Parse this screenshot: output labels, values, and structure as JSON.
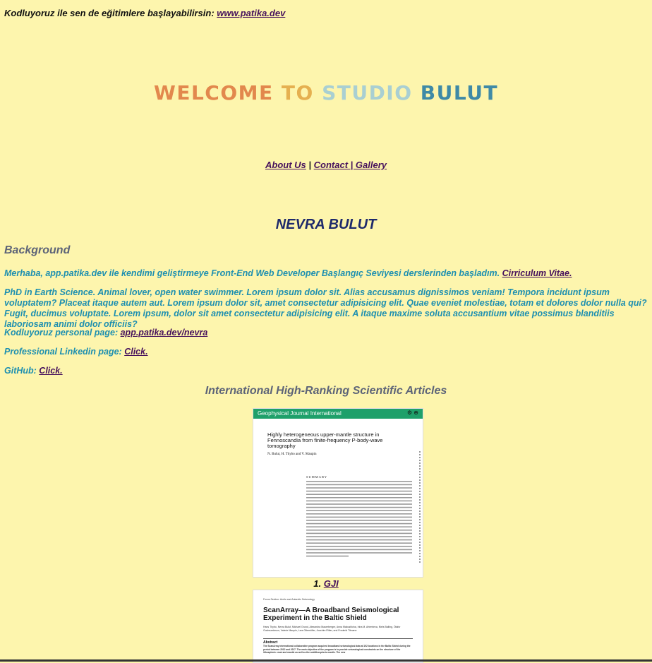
{
  "top": {
    "text": "Kodluyoruz ile sen de eğitimlere başlayabilirsin: ",
    "link": "www.patika.dev"
  },
  "welcome": {
    "word1": "WELCOME",
    "word2": "TO",
    "word3": "STUDIO",
    "word4": "BULUT",
    "colors": [
      "#e2884d",
      "#e5b050",
      "#a9cfd2",
      "#3f8aa6"
    ]
  },
  "nav": {
    "about": "About Us",
    "sep1": " | ",
    "contact": "Contact | ",
    "gallery": "Gallery"
  },
  "profile": {
    "name": "NEVRA BULUT",
    "background_heading": "Background",
    "intro": "Merhaba, app.patika.dev ile kendimi geliştirmeye Front-End Web Developer Başlangıç Seviyesi derslerinden başladım. ",
    "cv_link": "Cirriculum Vitae.",
    "bio": "PhD in Earth Science. Animal lover, open water swimmer. Lorem ipsum dolor sit. Alias accusamus dignissimos veniam! Tempora incidunt ipsum voluptatem? Placeat itaque autem aut. Lorem ipsum dolor sit, amet consectetur adipisicing elit. Quae eveniet molestiae, totam et dolores dolor nulla qui? Fugit, ducimus voluptate. Lorem ipsum, dolor sit amet consectetur adipisicing elit. A itaque maxime soluta accusantium vitae possimus blanditiis laboriosam animi dolor officiis?",
    "kodluyoruz_label": "Kodluyoruz personal page: ",
    "kodluyoruz_link": "app.patika.dev/nevra",
    "linkedin_label": "Professional Linkedin page: ",
    "linkedin_link": "Click.",
    "github_label": "GitHub: ",
    "github_link": "Click."
  },
  "articles": {
    "heading": "International High-Ranking Scientific Articles",
    "paper1": {
      "journal": "Geophysical Journal International",
      "title": "Highly heterogeneous upper-mantle structure in Fennoscandia from finite-frequency P-body-wave tomography",
      "authors": "N. Bulut, H. Thybo and V. Maupin",
      "summary_heading": "SUMMARY",
      "caption_num": "1. ",
      "caption_link": "GJI"
    },
    "paper2": {
      "section": "Focus Section: Arctic and Antarctic Seismology",
      "title": "ScanArray—A Broadband Seismological Experiment in the Baltic Shield",
      "authors": "Hans Thybo, Nevra Bulut, Michael Grund, Alexandra Mauerberger, Anna Makushkina, Irina M. Artemieva, Niels Balling, Ólafur Gudmundsson, Valerie Maupin, Lars Ottemöller, Joachim Ritter, and Frederik Tilmann",
      "abstract_heading": "Abstract",
      "abstract_text": "The ScanArray international collaborative program acquired broadband seismological data at 192 locations in the Baltic Shield during the period between 2012 and 2017. The main objective of the program is to provide seismological constraints on the structure of the lithospheric crust and mantle as well as the sublithospheric mantle. The new"
    }
  }
}
